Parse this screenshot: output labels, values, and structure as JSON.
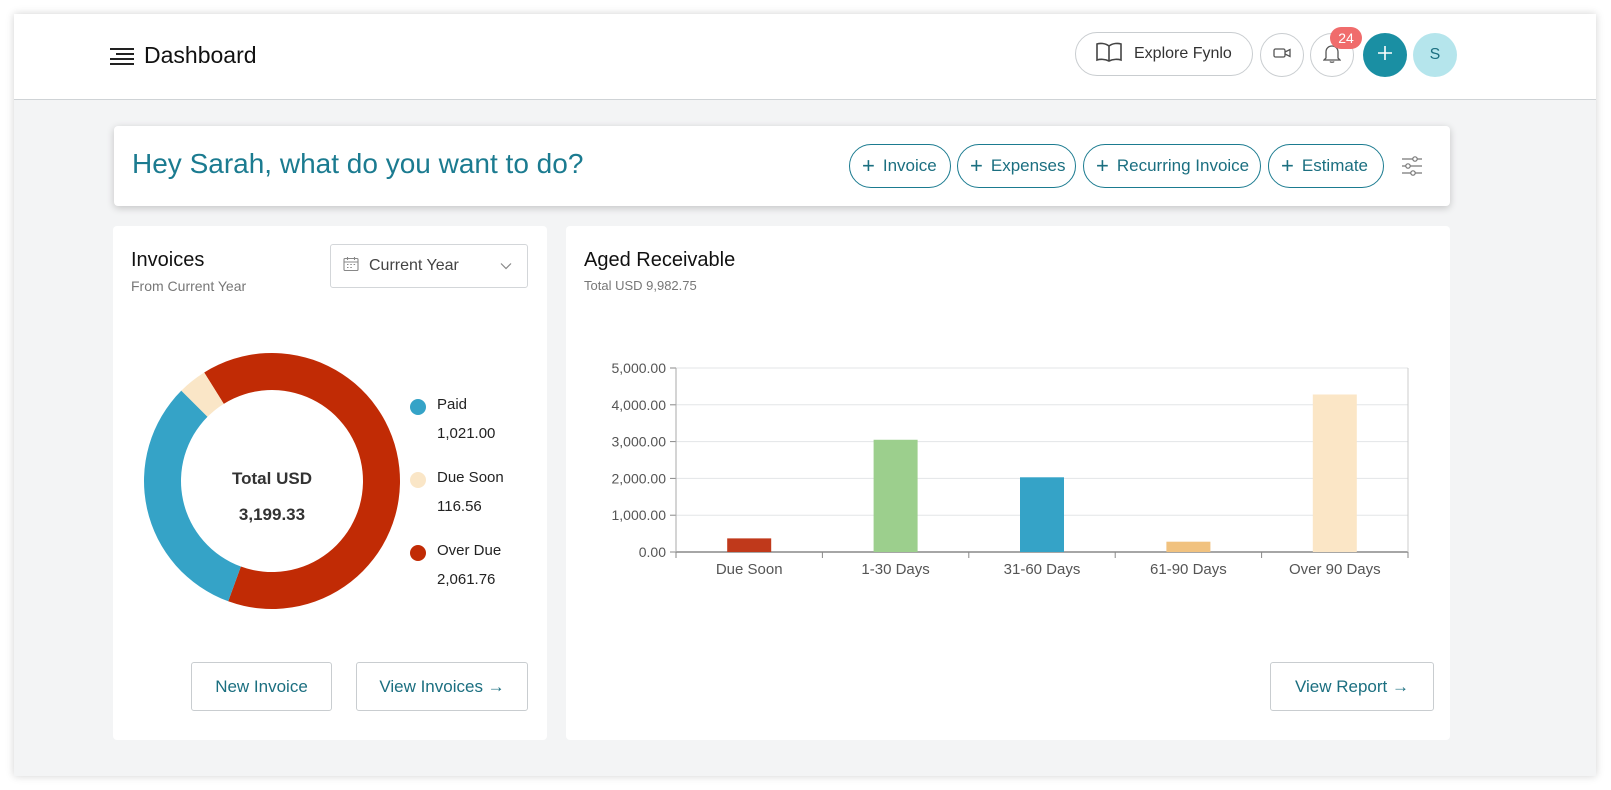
{
  "header": {
    "title": "Dashboard",
    "explore_label": "Explore Fynlo",
    "notification_count": "24",
    "avatar_initial": "S"
  },
  "quick_actions": {
    "greeting": "Hey Sarah, what do you want to do?",
    "buttons": [
      {
        "label": "Invoice"
      },
      {
        "label": "Expenses"
      },
      {
        "label": "Recurring Invoice"
      },
      {
        "label": "Estimate"
      }
    ]
  },
  "invoices": {
    "title": "Invoices",
    "subtitle": "From Current Year",
    "period": "Current Year",
    "center_label": "Total USD",
    "center_value": "3,199.33",
    "legend": [
      {
        "label": "Paid",
        "value": "1,021.00",
        "amount": 1021.0,
        "color": "#35a3c7"
      },
      {
        "label": "Due Soon",
        "value": "116.56",
        "amount": 116.56,
        "color": "#fae6c7"
      },
      {
        "label": "Over Due",
        "value": "2,061.76",
        "amount": 2061.76,
        "color": "#c12b05"
      }
    ],
    "new_invoice_label": "New Invoice",
    "view_invoices_label": "View Invoices →"
  },
  "aged": {
    "title": "Aged Receivable",
    "subtitle": "Total USD 9,982.75",
    "view_report_label": "View Report →"
  },
  "chart_data": {
    "type": "bar",
    "categories": [
      "Due Soon",
      "1-30 Days",
      "31-60 Days",
      "61-90 Days",
      "Over 90 Days"
    ],
    "values": [
      370,
      3050,
      2030,
      280,
      4280
    ],
    "colors": [
      "#c0391b",
      "#9ccf8d",
      "#35a3c7",
      "#f1c27f",
      "#fbe6c6"
    ],
    "y_ticks": [
      "0.00",
      "1,000.00",
      "2,000.00",
      "3,000.00",
      "4,000.00",
      "5,000.00"
    ],
    "ylim": [
      0,
      5000
    ],
    "grid": true,
    "legend": "none"
  }
}
